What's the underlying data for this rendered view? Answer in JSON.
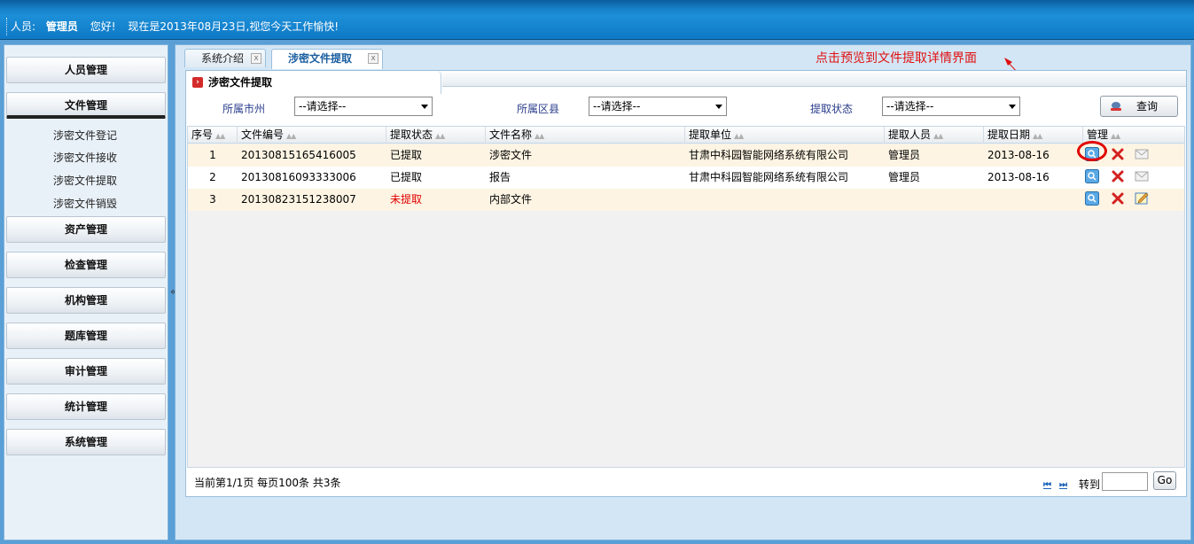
{
  "header": {
    "user_label": "人员:",
    "user_name": "管理员",
    "greeting": "您好!",
    "date_message": "现在是2013年08月23日,视您今天工作愉快!"
  },
  "sidebar": {
    "menus": [
      {
        "label": "人员管理"
      },
      {
        "label": "文件管理"
      },
      {
        "label": "资产管理"
      },
      {
        "label": "检查管理"
      },
      {
        "label": "机构管理"
      },
      {
        "label": "题库管理"
      },
      {
        "label": "审计管理"
      },
      {
        "label": "统计管理"
      },
      {
        "label": "系统管理"
      }
    ],
    "file_submenu": [
      "涉密文件登记",
      "涉密文件接收",
      "涉密文件提取",
      "涉密文件销毁"
    ],
    "collapse_glyph": "«"
  },
  "tabs": [
    {
      "label": "系统介绍",
      "close": "x"
    },
    {
      "label": "涉密文件提取",
      "close": "x"
    }
  ],
  "annotation": "点击预览到文件提取详情界面",
  "panel": {
    "title": "涉密文件提取"
  },
  "filters": {
    "city_label": "所属市州",
    "city_value": "--请选择--",
    "county_label": "所属区县",
    "county_value": "--请选择--",
    "status_label": "提取状态",
    "status_value": "--请选择--",
    "query_label": "查询"
  },
  "grid": {
    "columns": [
      "序号",
      "文件编号",
      "提取状态",
      "文件名称",
      "提取单位",
      "提取人员",
      "提取日期",
      "管理"
    ],
    "rows": [
      {
        "no": "1",
        "file_no": "20130815165416005",
        "status": "已提取",
        "name": "涉密文件",
        "unit": "甘肃中科园智能网络系统有限公司",
        "person": "管理员",
        "date": "2013-08-16"
      },
      {
        "no": "2",
        "file_no": "20130816093333006",
        "status": "已提取",
        "name": "报告",
        "unit": "甘肃中科园智能网络系统有限公司",
        "person": "管理员",
        "date": "2013-08-16"
      },
      {
        "no": "3",
        "file_no": "20130823151238007",
        "status": "未提取",
        "name": "内部文件",
        "unit": "",
        "person": "",
        "date": ""
      }
    ]
  },
  "footer": {
    "page_info": "当前第1/1页  每页100条  共3条",
    "first": "⏮",
    "last": "⏭",
    "goto_label": "转到",
    "go_label": "Go"
  },
  "colors": {
    "accent_blue": "#1d8fd8",
    "unextracted_red": "#e00000",
    "annotation_red": "#e01010"
  }
}
